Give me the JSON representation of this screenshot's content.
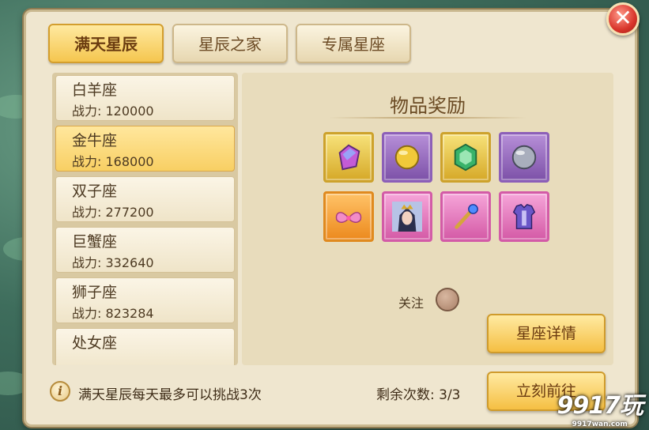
{
  "tabs": [
    {
      "label": "满天星辰",
      "active": true
    },
    {
      "label": "星辰之家",
      "active": false
    },
    {
      "label": "专属星座",
      "active": false
    }
  ],
  "constellations": [
    {
      "name": "白羊座",
      "power_label": "战力:",
      "power": "120000",
      "active": false
    },
    {
      "name": "金牛座",
      "power_label": "战力:",
      "power": "168000",
      "active": true
    },
    {
      "name": "双子座",
      "power_label": "战力:",
      "power": "277200",
      "active": false
    },
    {
      "name": "巨蟹座",
      "power_label": "战力:",
      "power": "332640",
      "active": false
    },
    {
      "name": "狮子座",
      "power_label": "战力:",
      "power": "823284",
      "active": false
    },
    {
      "name": "处女座",
      "power_label": "",
      "power": "",
      "active": false
    }
  ],
  "rewards": {
    "title": "物品奖励",
    "items": [
      {
        "icon": "crystal-gem-icon",
        "frame": "yellow"
      },
      {
        "icon": "gold-orb-icon",
        "frame": "purple"
      },
      {
        "icon": "green-emerald-icon",
        "frame": "yellow"
      },
      {
        "icon": "silver-orb-icon",
        "frame": "purple"
      },
      {
        "icon": "pink-wings-icon",
        "frame": "orange"
      },
      {
        "icon": "hero-portrait-icon",
        "frame": "pink"
      },
      {
        "icon": "magic-staff-icon",
        "frame": "pink"
      },
      {
        "icon": "armor-icon",
        "frame": "pink"
      }
    ]
  },
  "follow_label": "关注",
  "details_button": "星座详情",
  "go_button": "立刻前往",
  "footer": {
    "info": "满天星辰每天最多可以挑战3次",
    "remain_label": "剩余次数:",
    "remain_value": "3/3"
  },
  "watermark": {
    "big": "9917玩",
    "small": "9917wan.com"
  },
  "colors": {
    "accent": "#f5c64f",
    "panel": "#efe6cf",
    "close": "#d8352b"
  }
}
